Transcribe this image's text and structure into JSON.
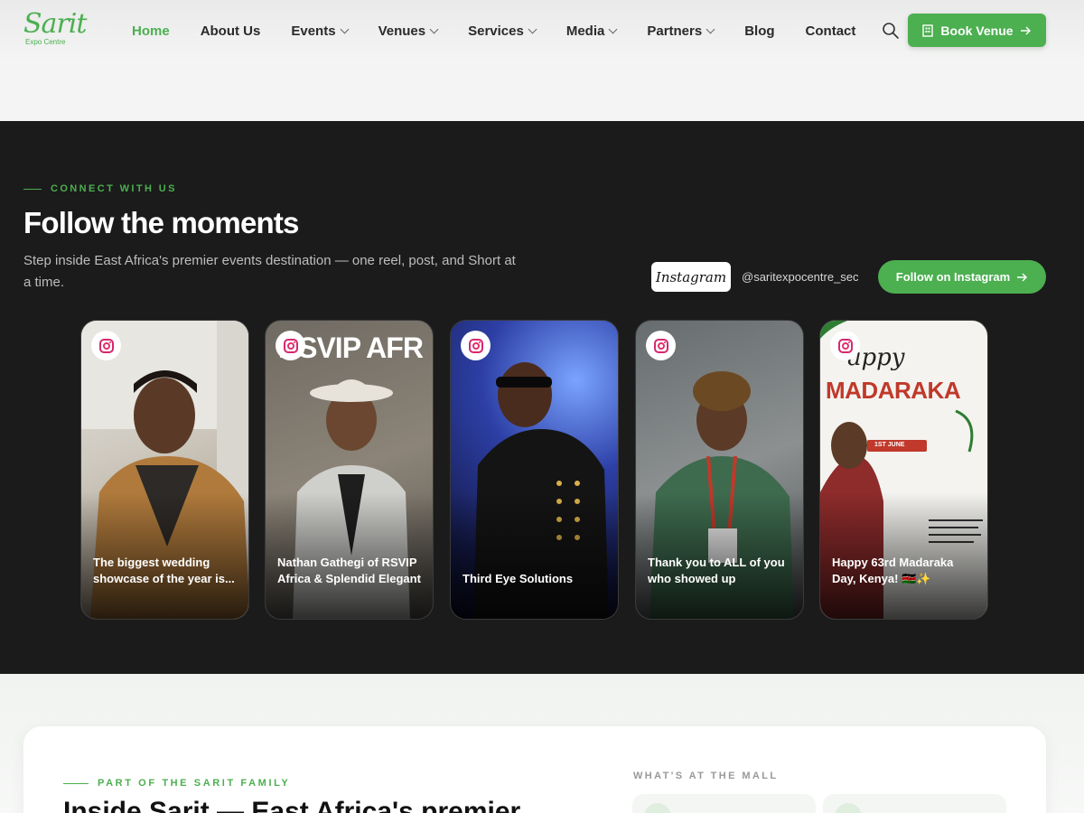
{
  "header": {
    "logo_text": "Sarit",
    "logo_sub": "Expo Centre",
    "nav": [
      {
        "label": "Home",
        "active": true,
        "dropdown": false
      },
      {
        "label": "About Us",
        "active": false,
        "dropdown": false
      },
      {
        "label": "Events",
        "active": false,
        "dropdown": true
      },
      {
        "label": "Venues",
        "active": false,
        "dropdown": true
      },
      {
        "label": "Services",
        "active": false,
        "dropdown": true
      },
      {
        "label": "Media",
        "active": false,
        "dropdown": true
      },
      {
        "label": "Partners",
        "active": false,
        "dropdown": true
      },
      {
        "label": "Blog",
        "active": false,
        "dropdown": false
      },
      {
        "label": "Contact",
        "active": false,
        "dropdown": false
      }
    ],
    "book_label": "Book Venue"
  },
  "social": {
    "eyebrow": "CONNECT WITH US",
    "title": "Follow the moments",
    "subtitle": "Step inside East Africa's premier events destination — one reel, post, and Short at a time.",
    "ig_badge": "Instagram",
    "handle": "@saritexpocentre_sec",
    "follow_label": "Follow on Instagram",
    "cards": [
      {
        "caption": "The biggest wedding showcase of the year is...",
        "overlay": ""
      },
      {
        "caption": "Nathan Gathegi of RSVIP Africa & Splendid Elegant",
        "overlay": "RSVIP AFR"
      },
      {
        "caption": "Third Eye Solutions",
        "overlay": ""
      },
      {
        "caption": "Thank you to ALL of you who showed up",
        "overlay": ""
      },
      {
        "caption": "Happy 63rd Madaraka Day, Kenya! 🇰🇪✨",
        "overlay": "MADARAKA",
        "overlay2": "appy",
        "overlay3": "1ST JUNE"
      }
    ]
  },
  "family": {
    "eyebrow": "PART OF THE SARIT FAMILY",
    "title": "Inside Sarit — East Africa's premier",
    "mall_label": "WHAT'S AT THE MALL"
  },
  "colors": {
    "accent": "#4caf50",
    "dark_bg": "#1b1b1b"
  }
}
